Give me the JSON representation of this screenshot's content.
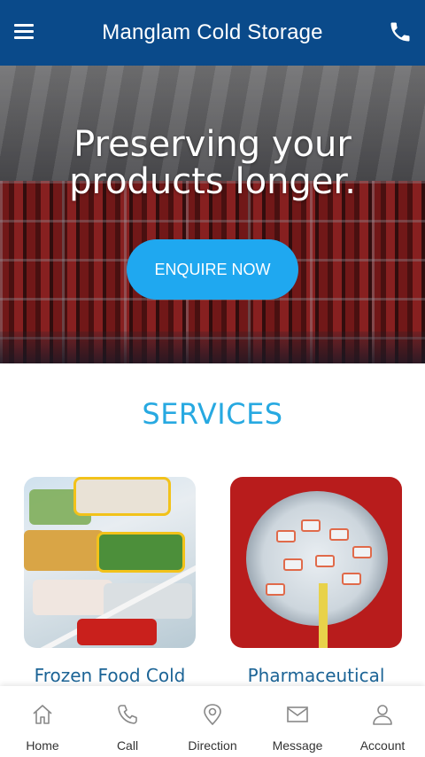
{
  "header": {
    "title": "Manglam Cold Storage",
    "menu_icon": "hamburger-menu-icon",
    "phone_icon": "phone-icon",
    "bg_color": "#0a4a8a"
  },
  "hero": {
    "headline_line1": "Preserving your",
    "headline_line2": "products longer.",
    "cta_label": "ENQUIRE NOW",
    "cta_color": "#1fa8f0"
  },
  "services": {
    "title": "SERVICES",
    "title_color": "#27a9e1",
    "items": [
      {
        "label": "Frozen Food Cold",
        "image": "frozen-food-containers-image"
      },
      {
        "label": "Pharmaceutical",
        "image": "pharmaceutical-storage-image"
      }
    ]
  },
  "bottom_nav": {
    "items": [
      {
        "label": "Home",
        "icon": "home-icon"
      },
      {
        "label": "Call",
        "icon": "phone-icon"
      },
      {
        "label": "Direction",
        "icon": "map-pin-icon"
      },
      {
        "label": "Message",
        "icon": "envelope-icon"
      },
      {
        "label": "Account",
        "icon": "user-icon"
      }
    ]
  }
}
